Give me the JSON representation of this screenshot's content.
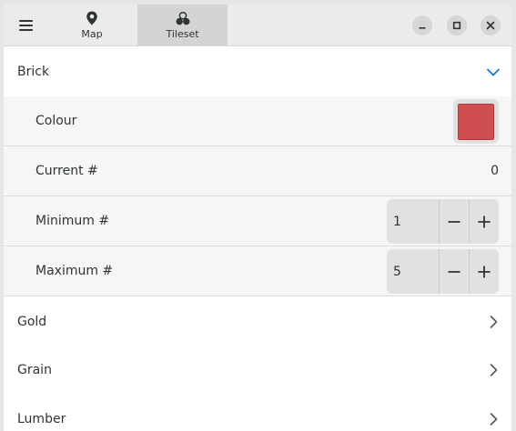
{
  "header": {
    "menu_icon": "hamburger-menu-icon",
    "tabs": [
      {
        "label": "Map",
        "icon": "map-pin-icon",
        "selected": false
      },
      {
        "label": "Tileset",
        "icon": "tileset-icon",
        "selected": true
      }
    ],
    "window_controls": [
      "minimize-icon",
      "maximize-icon",
      "close-icon"
    ]
  },
  "resources": [
    {
      "label": "Brick",
      "expanded": true
    },
    {
      "label": "Gold",
      "expanded": false
    },
    {
      "label": "Grain",
      "expanded": false
    },
    {
      "label": "Lumber",
      "expanded": false
    }
  ],
  "brick_details": {
    "colour_label": "Colour",
    "colour_value": "#cf4f50",
    "current_label": "Current #",
    "current_value": "0",
    "minimum_label": "Minimum #",
    "minimum_value": "1",
    "maximum_label": "Maximum #",
    "maximum_value": "5"
  },
  "colors": {
    "accent": "#1c71d8",
    "header_bg": "#ebebeb",
    "selected_tab_bg": "#d4d4d4"
  }
}
